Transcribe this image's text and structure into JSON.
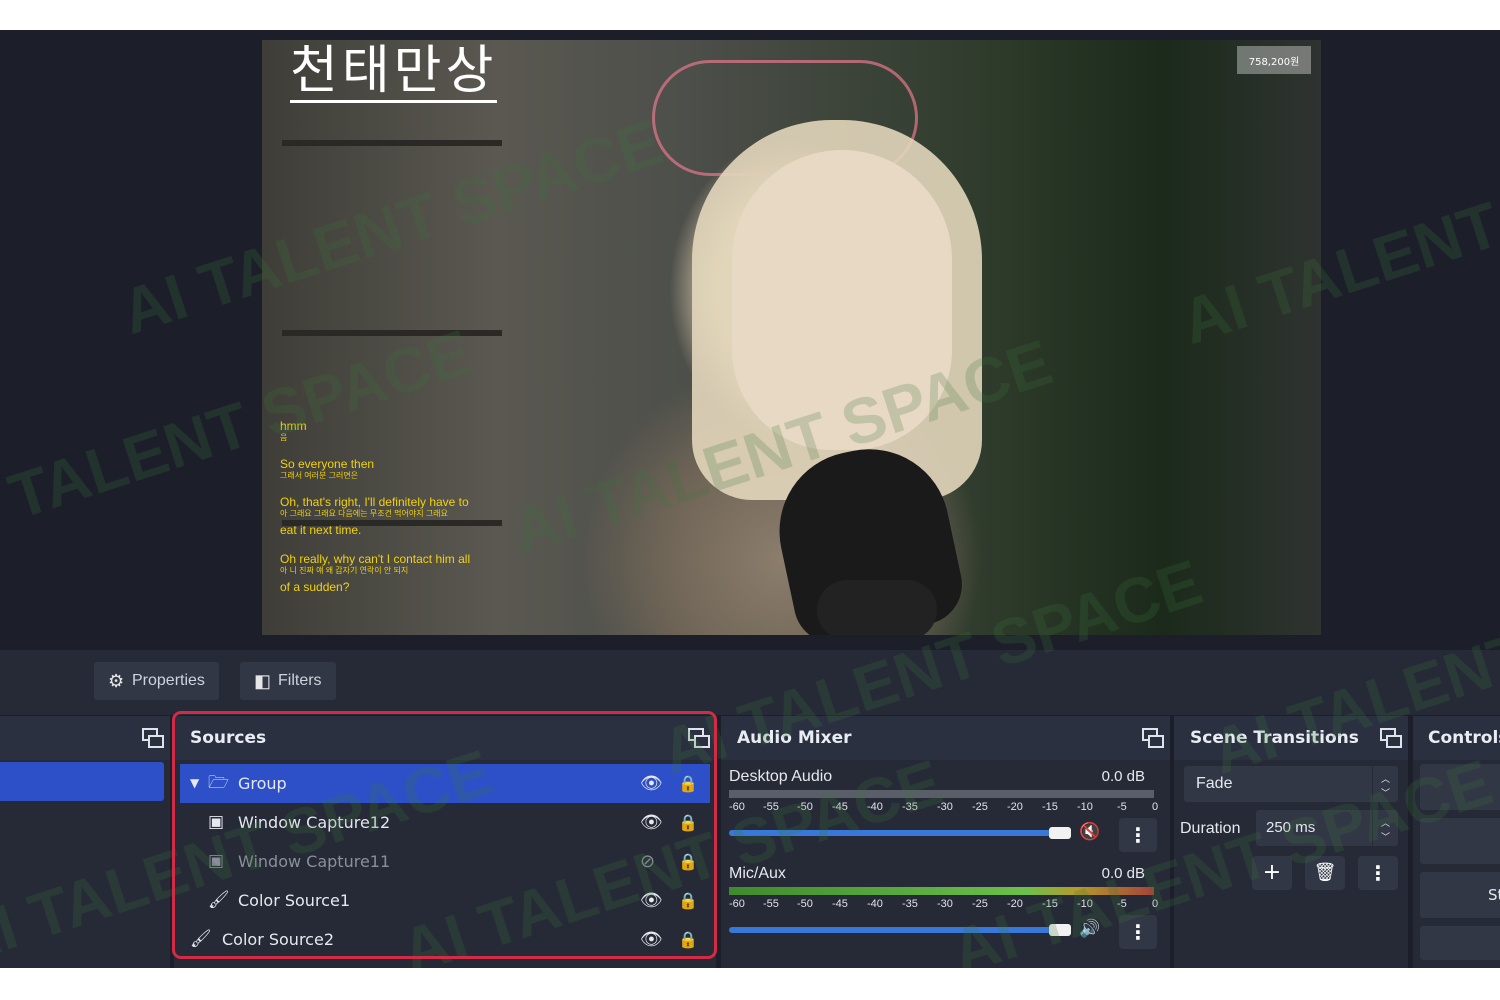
{
  "preview": {
    "overlay_title": "천태만상",
    "viewer_count": "758,200원",
    "subtitles": [
      {
        "en": "hmm",
        "kr": "음"
      },
      {
        "en": "So everyone then",
        "kr": "그래서 여러분 그러면은"
      },
      {
        "en": "Oh, that's right, I'll definitely have to",
        "kr": "아 그래요 그래요 다음에는 무조건 먹어야지 그래요"
      },
      {
        "en": "eat it next time.",
        "kr": ""
      },
      {
        "en": "Oh really, why can't I contact him all",
        "kr": "아 니 진짜 얘 왜 갑자기 연락이 안 되지"
      },
      {
        "en": "of a sudden?",
        "kr": ""
      }
    ]
  },
  "toolbar": {
    "properties_label": "Properties",
    "filters_label": "Filters"
  },
  "sources": {
    "title": "Sources",
    "items": [
      {
        "label": "Group",
        "icon": "folder-icon",
        "visible": true
      },
      {
        "label": "Window Capture12",
        "icon": "window-icon",
        "visible": true
      },
      {
        "label": "Window Capture11",
        "icon": "window-icon",
        "visible": false
      },
      {
        "label": "Color Source1",
        "icon": "brush-icon",
        "visible": true
      },
      {
        "label": "Color Source2",
        "icon": "brush-icon",
        "visible": true
      }
    ]
  },
  "audio_mixer": {
    "title": "Audio Mixer",
    "ticks": [
      "-60",
      "-55",
      "-50",
      "-45",
      "-40",
      "-35",
      "-30",
      "-25",
      "-20",
      "-15",
      "-10",
      "-5",
      "0"
    ],
    "channels": [
      {
        "name": "Desktop Audio",
        "db": "0.0 dB",
        "muted": true,
        "volume": 1.0
      },
      {
        "name": "Mic/Aux",
        "db": "0.0 dB",
        "muted": false,
        "volume": 1.0
      }
    ]
  },
  "scene_transitions": {
    "title": "Scene Transitions",
    "transition": "Fade",
    "duration_label": "Duration",
    "duration_value": "250 ms"
  },
  "controls": {
    "title": "Controls",
    "button_partial": "St"
  },
  "watermark": {
    "text": "AI TALENT SPACE"
  },
  "colors": {
    "selection": "#2d50c8",
    "highlight_border": "#d22b45",
    "fader": "#3778d8",
    "subtitle_yellow": "#f2d20c"
  }
}
